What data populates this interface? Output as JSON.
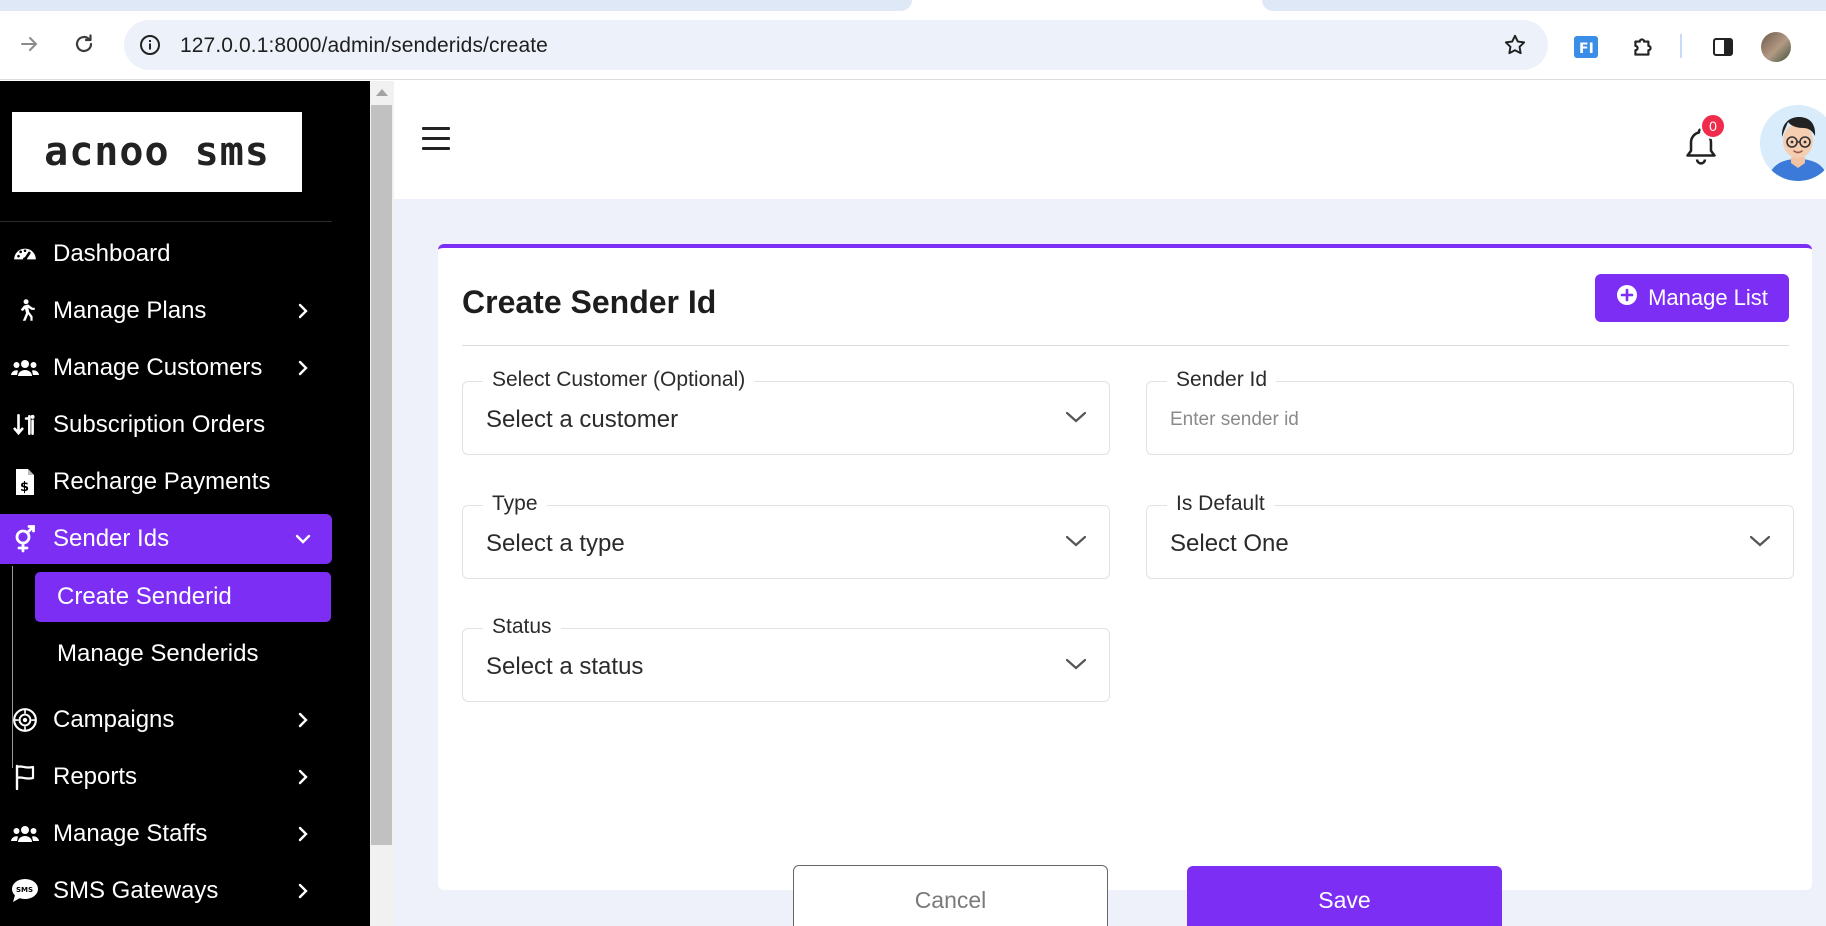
{
  "browser": {
    "url": "127.0.0.1:8000/admin/senderids/create",
    "extension_label": "FI"
  },
  "sidebar": {
    "logo": "acnoo sms",
    "items": [
      {
        "label": "Dashboard",
        "icon": "dashboard-gauge-icon",
        "has_chevron": false
      },
      {
        "label": "Manage Plans",
        "icon": "walking-person-icon",
        "has_chevron": true
      },
      {
        "label": "Manage Customers",
        "icon": "users-icon",
        "has_chevron": true
      },
      {
        "label": "Subscription Orders",
        "icon": "sort-arrows-icon",
        "has_chevron": false
      },
      {
        "label": "Recharge Payments",
        "icon": "invoice-dollar-icon",
        "has_chevron": false
      },
      {
        "label": "Sender Ids",
        "icon": "gender-icon",
        "has_chevron": true,
        "active": true,
        "expanded": true
      },
      {
        "label": "Campaigns",
        "icon": "campaign-icon",
        "has_chevron": true
      },
      {
        "label": "Reports",
        "icon": "flag-icon",
        "has_chevron": true
      },
      {
        "label": "Manage Staffs",
        "icon": "users-icon",
        "has_chevron": true
      },
      {
        "label": "SMS Gateways",
        "icon": "sms-bubble-icon",
        "has_chevron": true
      }
    ],
    "subitems": [
      {
        "label": "Create Senderid",
        "active": true
      },
      {
        "label": "Manage Senderids",
        "active": false
      }
    ]
  },
  "topbar": {
    "notification_count": "0"
  },
  "card": {
    "title": "Create Sender Id",
    "manage_button": "Manage List"
  },
  "form": {
    "customer": {
      "label": "Select Customer (Optional)",
      "value": "Select a customer"
    },
    "sender_id": {
      "label": "Sender Id",
      "placeholder": "Enter sender id"
    },
    "type": {
      "label": "Type",
      "value": "Select a type"
    },
    "is_default": {
      "label": "Is Default",
      "value": "Select One"
    },
    "status": {
      "label": "Status",
      "value": "Select a status"
    },
    "cancel": "Cancel",
    "save": "Save"
  },
  "colors": {
    "accent": "#7c2ef5",
    "sidebar_bg": "#000000",
    "page_bg": "#eef1f9",
    "badge": "#ef2c4b"
  }
}
